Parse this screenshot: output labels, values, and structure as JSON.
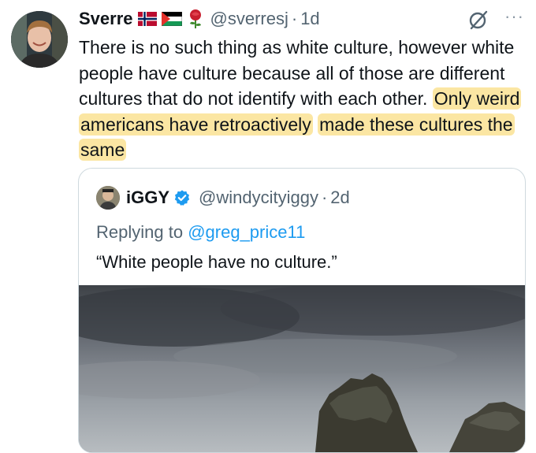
{
  "tweet": {
    "author_name": "Sverre",
    "handle": "@sverresj",
    "separator": "·",
    "time": "1d",
    "text_plain": "There is no such thing as white culture, however white people have culture because all of those are different cultures that do not identify with each other.",
    "text_highlight_1": "Only weird americans have retroactively",
    "text_highlight_2": "made these cultures the same",
    "more_label": "···",
    "emoji": [
      "norway-flag",
      "palestine-flag",
      "rose"
    ]
  },
  "quoted_tweet": {
    "author_name": "iGGY",
    "handle": "@windycityiggy",
    "separator": "·",
    "time": "2d",
    "replying_prefix": "Replying to",
    "replying_mention": "@greg_price11",
    "text": "“White people have no culture.”"
  },
  "colors": {
    "highlight": "#fbe6a3",
    "link": "#1d9bf0",
    "muted": "#536471",
    "verified": "#1d9bf0"
  }
}
